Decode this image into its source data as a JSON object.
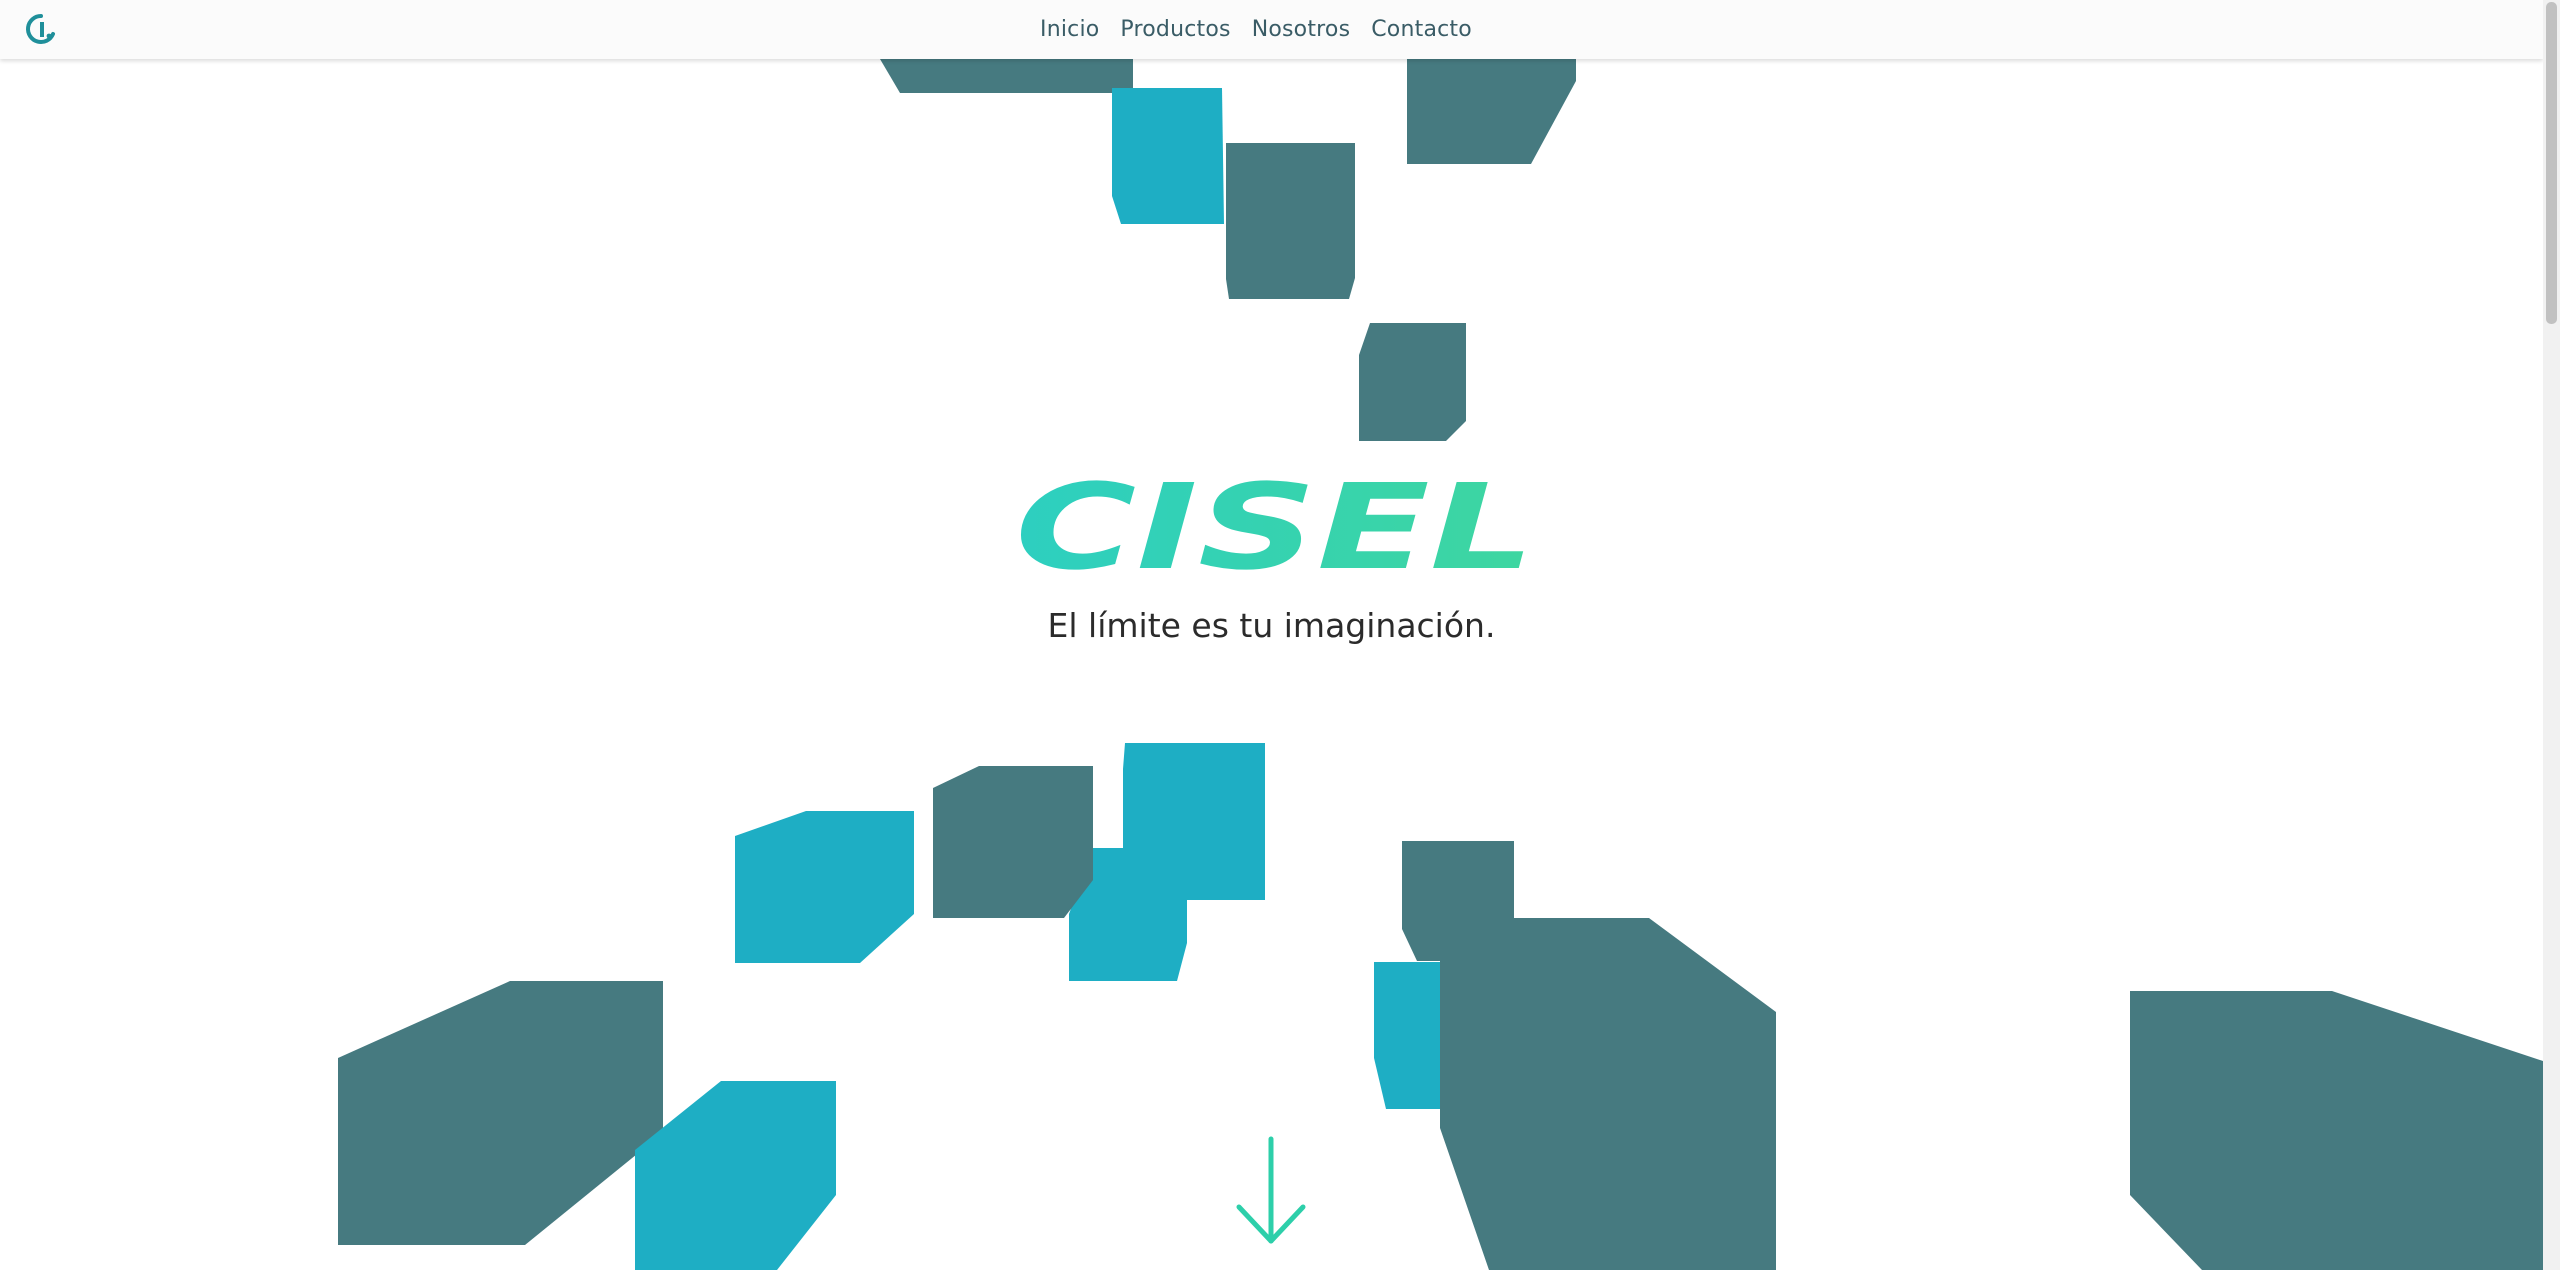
{
  "nav": {
    "links": [
      {
        "label": "Inicio"
      },
      {
        "label": "Productos"
      },
      {
        "label": "Nosotros"
      },
      {
        "label": "Contacto"
      }
    ]
  },
  "hero": {
    "brand_text": "CISEL",
    "tagline": "El límite es tu imaginación."
  },
  "colors": {
    "dark_teal": "#467a80",
    "light_teal": "#1eaec4",
    "brand_gradient_start": "#2dcfc0",
    "brand_gradient_end": "#3ed6a0",
    "nav_text": "#3a5c66",
    "logo": "#1f8f9a"
  },
  "icons": {
    "logo": "cisel-logo-icon",
    "scroll": "arrow-down-icon"
  }
}
